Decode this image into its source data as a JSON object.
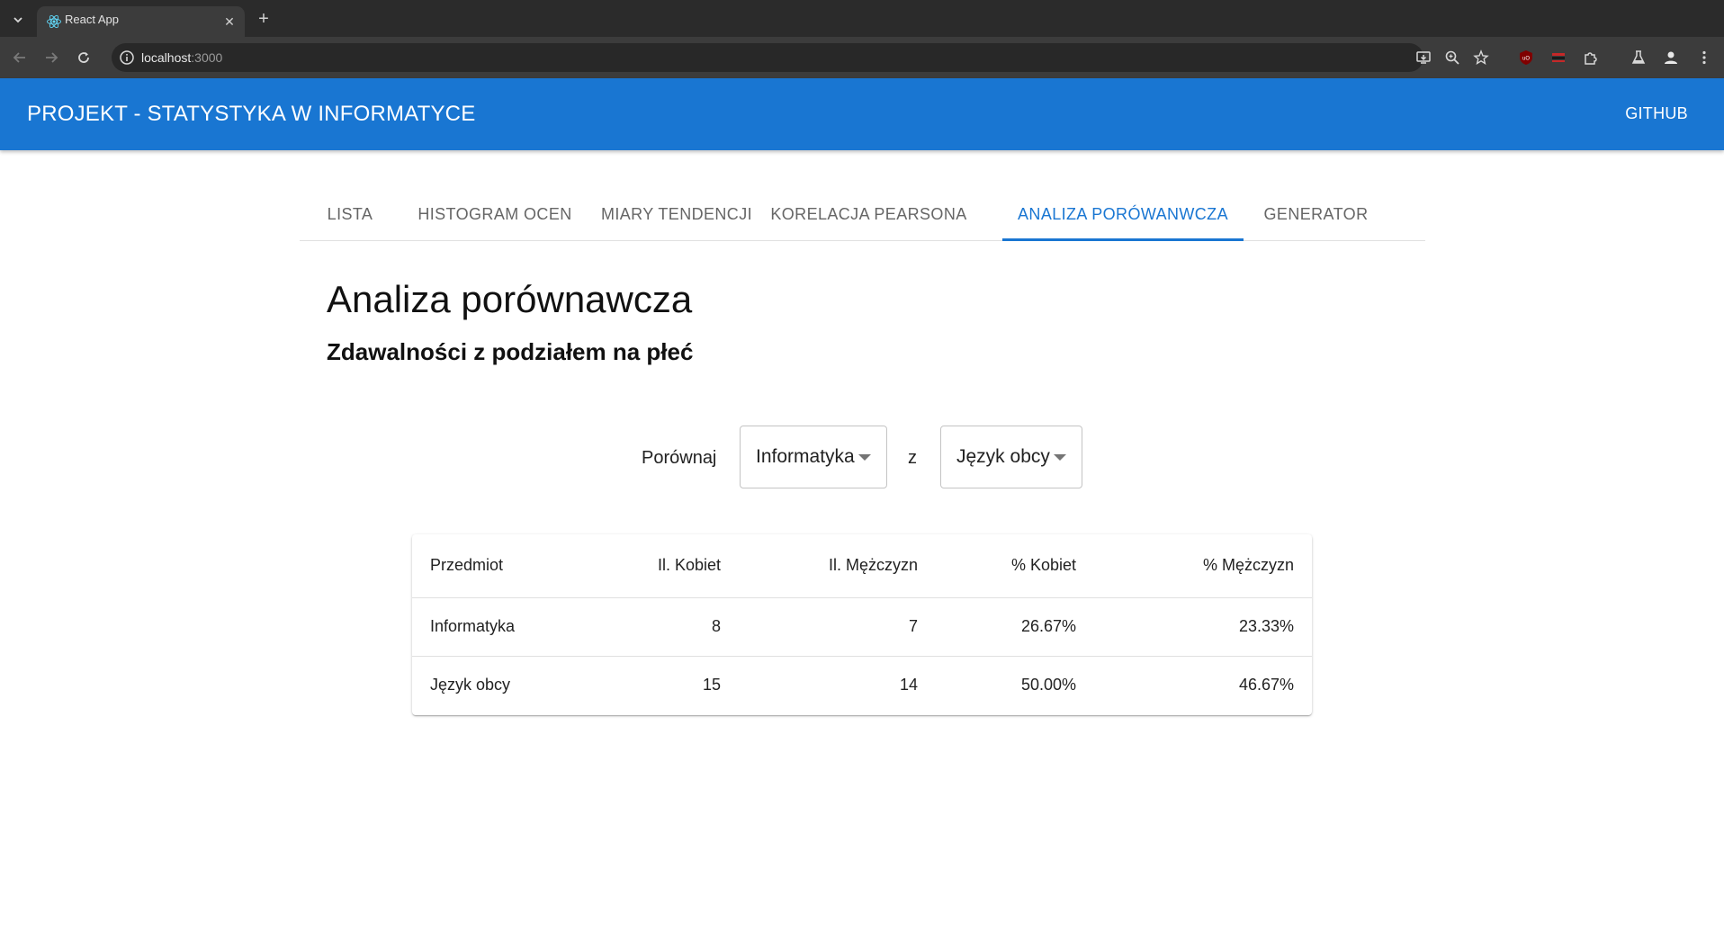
{
  "browser": {
    "tab_title": "React App",
    "url_host": "localhost",
    "url_port": ":3000"
  },
  "app": {
    "title": "PROJEKT - STATYSTYKA W INFORMATYCE",
    "github": "GITHUB"
  },
  "tabs": [
    {
      "label": "LISTA"
    },
    {
      "label": "HISTOGRAM OCEN"
    },
    {
      "label": "MIARY TENDENCJI"
    },
    {
      "label": "KORELACJA PEARSONA"
    },
    {
      "label": "ANALIZA PORÓWANWCZA"
    },
    {
      "label": "GENERATOR"
    }
  ],
  "active_tab": "ANALIZA PORÓWANWCZA",
  "page": {
    "heading": "Analiza porównawcza",
    "subheading": "Zdawalności z podziałem na płeć"
  },
  "compare": {
    "label": "Porównaj",
    "first_value": "Informatyka",
    "connector": "z",
    "second_value": "Język obcy"
  },
  "table": {
    "headers": [
      "Przedmiot",
      "Il. Kobiet",
      "Il. Mężczyzn",
      "% Kobiet",
      "% Mężczyzn"
    ],
    "rows": [
      [
        "Informatyka",
        "8",
        "7",
        "26.67%",
        "23.33%"
      ],
      [
        "Język obcy",
        "15",
        "14",
        "50.00%",
        "46.67%"
      ]
    ]
  },
  "colors": {
    "primary": "#1976d2",
    "chrome_dark": "#2b2b2b",
    "chrome_toolbar": "#3c3c3c"
  }
}
